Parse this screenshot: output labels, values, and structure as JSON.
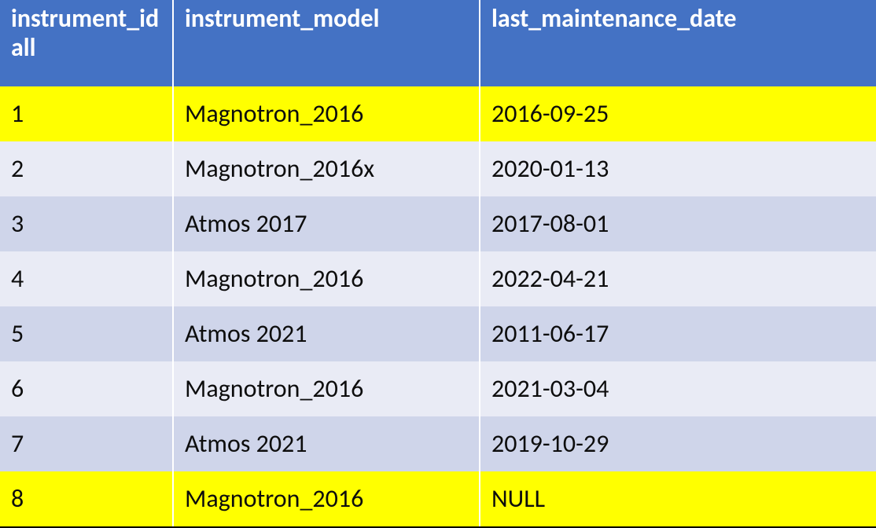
{
  "table": {
    "columns": [
      {
        "label": "instrument_id all"
      },
      {
        "label": "instrument_model"
      },
      {
        "label": "last_maintenance_date"
      }
    ],
    "rows": [
      {
        "instrument_id": "1",
        "instrument_model": "Magnotron_2016",
        "last_maintenance_date": "2016-09-25",
        "highlight": true
      },
      {
        "instrument_id": "2",
        "instrument_model": "Magnotron_2016x",
        "last_maintenance_date": "2020-01-13",
        "highlight": false
      },
      {
        "instrument_id": "3",
        "instrument_model": "Atmos 2017",
        "last_maintenance_date": "2017-08-01",
        "highlight": false
      },
      {
        "instrument_id": "4",
        "instrument_model": "Magnotron_2016",
        "last_maintenance_date": "2022-04-21",
        "highlight": false
      },
      {
        "instrument_id": "5",
        "instrument_model": "Atmos 2021",
        "last_maintenance_date": "2011-06-17",
        "highlight": false
      },
      {
        "instrument_id": "6",
        "instrument_model": "Magnotron_2016",
        "last_maintenance_date": "2021-03-04",
        "highlight": false
      },
      {
        "instrument_id": "7",
        "instrument_model": "Atmos 2021",
        "last_maintenance_date": "2019-10-29",
        "highlight": false
      },
      {
        "instrument_id": "8",
        "instrument_model": "Magnotron_2016",
        "last_maintenance_date": "NULL",
        "highlight": true
      }
    ]
  }
}
